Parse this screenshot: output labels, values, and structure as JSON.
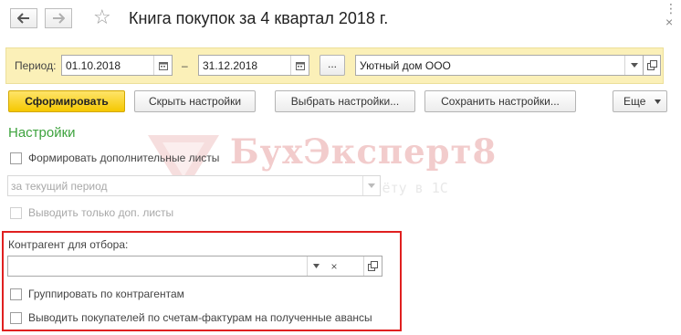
{
  "window": {
    "title": "Книга покупок за 4 квартал 2018 г.",
    "more_icon": "kebab-menu-icon",
    "close_icon": "close-icon"
  },
  "nav": {
    "back_icon": "arrow-left-icon",
    "forward_icon": "arrow-right-icon",
    "favorite_icon": "star-icon"
  },
  "period": {
    "label": "Период:",
    "date_from": "01.10.2018",
    "separator": "–",
    "date_to": "31.12.2018",
    "choose_label": "...",
    "organization": "Уютный дом ООО"
  },
  "toolbar": {
    "generate": "Сформировать",
    "hide_settings": "Скрыть настройки",
    "choose_settings": "Выбрать настройки...",
    "save_settings": "Сохранить настройки...",
    "more": "Еще"
  },
  "settings": {
    "title": "Настройки",
    "extra_sheets": "Формировать дополнительные листы",
    "period_select": "за текущий период",
    "only_extra_sheets": "Выводить только доп. листы",
    "counterparty_label": "Контрагент для отбора:",
    "counterparty_value": "",
    "group_by_counterparty": "Группировать по контрагентам",
    "show_buyers_advances": "Выводить покупателей по счетам-фактурам на полученные авансы"
  },
  "watermark": {
    "name": "БухЭксперт8",
    "subtitle": "База ответов по учёту в 1С"
  },
  "colors": {
    "period_bar": "#fbf0b8",
    "primary_button": "#f5c800",
    "section_title": "#3ea33e",
    "highlight_frame": "#e02020"
  }
}
